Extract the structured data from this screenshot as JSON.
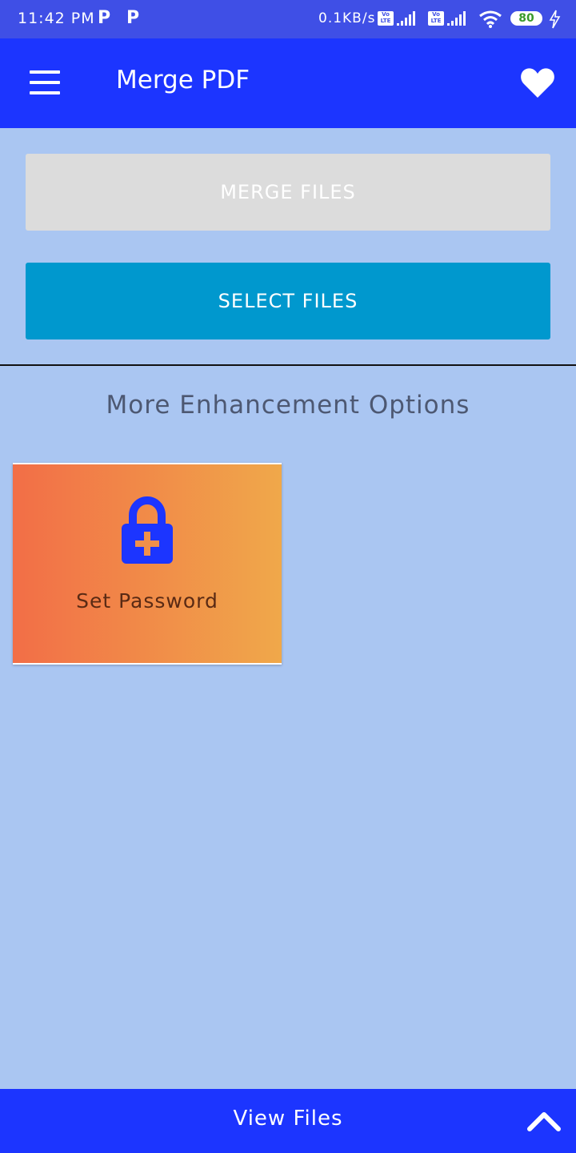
{
  "status_bar": {
    "time": "11:42 PM",
    "notification_icons": [
      "P",
      "P"
    ],
    "net_speed": "0.1KB/s",
    "volte_label": "Vo LTE",
    "battery": "80"
  },
  "app_bar": {
    "title": "Merge PDF",
    "menu_icon": "hamburger-menu-icon",
    "favorite_icon": "heart-icon"
  },
  "actions": {
    "merge_label": "MERGE FILES",
    "select_label": "SELECT FILES"
  },
  "enhancement": {
    "title": "More Enhancement Options",
    "options": [
      {
        "label": "Set Password",
        "icon": "lock-plus-icon"
      }
    ]
  },
  "bottom_bar": {
    "label": "View Files",
    "icon": "chevron-up-icon"
  },
  "colors": {
    "app_bar": "#1c35ff",
    "background": "#aac6f2",
    "select_button": "#0098ce",
    "merge_button_disabled": "#dcdcdc",
    "card_gradient_start": "#f26e47",
    "card_gradient_end": "#f0a84a"
  }
}
